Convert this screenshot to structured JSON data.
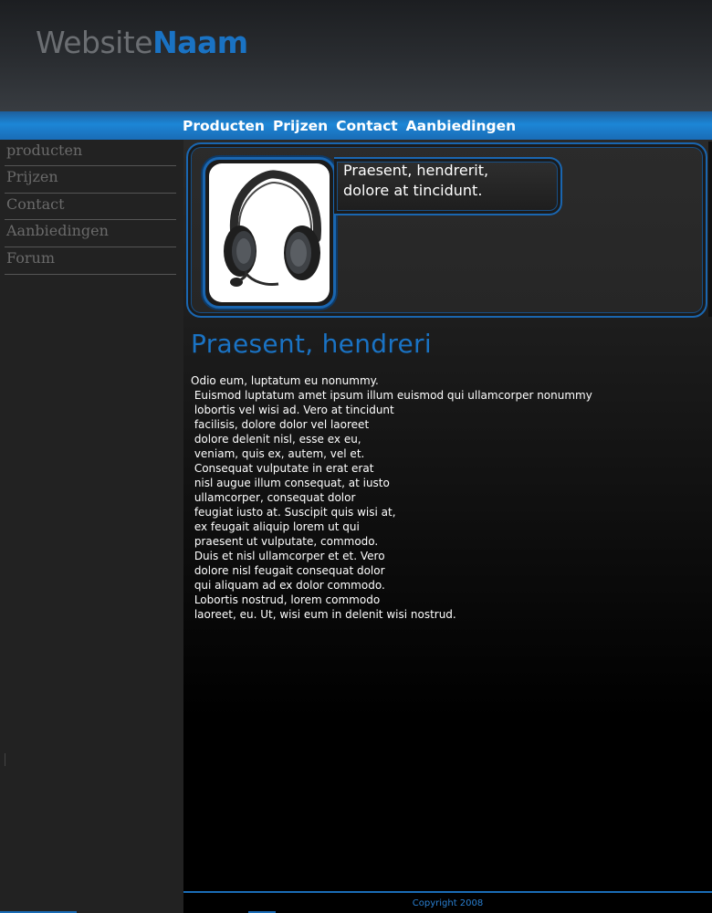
{
  "header": {
    "logo_part1": "Website",
    "logo_part2": "Naam"
  },
  "topnav": {
    "items": [
      "Producten",
      "Prijzen",
      "Contact",
      "Aanbiedingen"
    ]
  },
  "sidebar": {
    "items": [
      "producten",
      "Prijzen",
      "Contact",
      "Aanbiedingen",
      "Forum"
    ]
  },
  "feature": {
    "image_icon": "headphones-image",
    "caption": "Praesent, hendrerit,\ndolore at tincidunt."
  },
  "content": {
    "title": "Praesent, hendreri",
    "body": "Odio eum, luptatum eu nonummy.\n Euismod luptatum amet ipsum illum euismod qui ullamcorper nonummy\n lobortis vel wisi ad. Vero at tincidunt\n facilisis, dolore dolor vel laoreet\n dolore delenit nisl, esse ex eu,\n veniam, quis ex, autem, vel et.\n Consequat vulputate in erat erat\n nisl augue illum consequat, at iusto\n ullamcorper, consequat dolor\n feugiat iusto at. Suscipit quis wisi at,\n ex feugait aliquip lorem ut qui\n praesent ut vulputate, commodo.\n Duis et nisl ullamcorper et et. Vero\n dolore nisl feugait consequat dolor\n qui aliquam ad ex dolor commodo.\n Lobortis nostrud, lorem commodo\n laoreet, eu. Ut, wisi eum in delenit wisi nostrud."
  },
  "footer": {
    "copyright": "Copyright 2008"
  },
  "colors": {
    "accent": "#1a73c4",
    "nav_bar": "#1c86d6",
    "sidebar_bg": "#222222",
    "sidebar_text": "#6a6a6a"
  }
}
